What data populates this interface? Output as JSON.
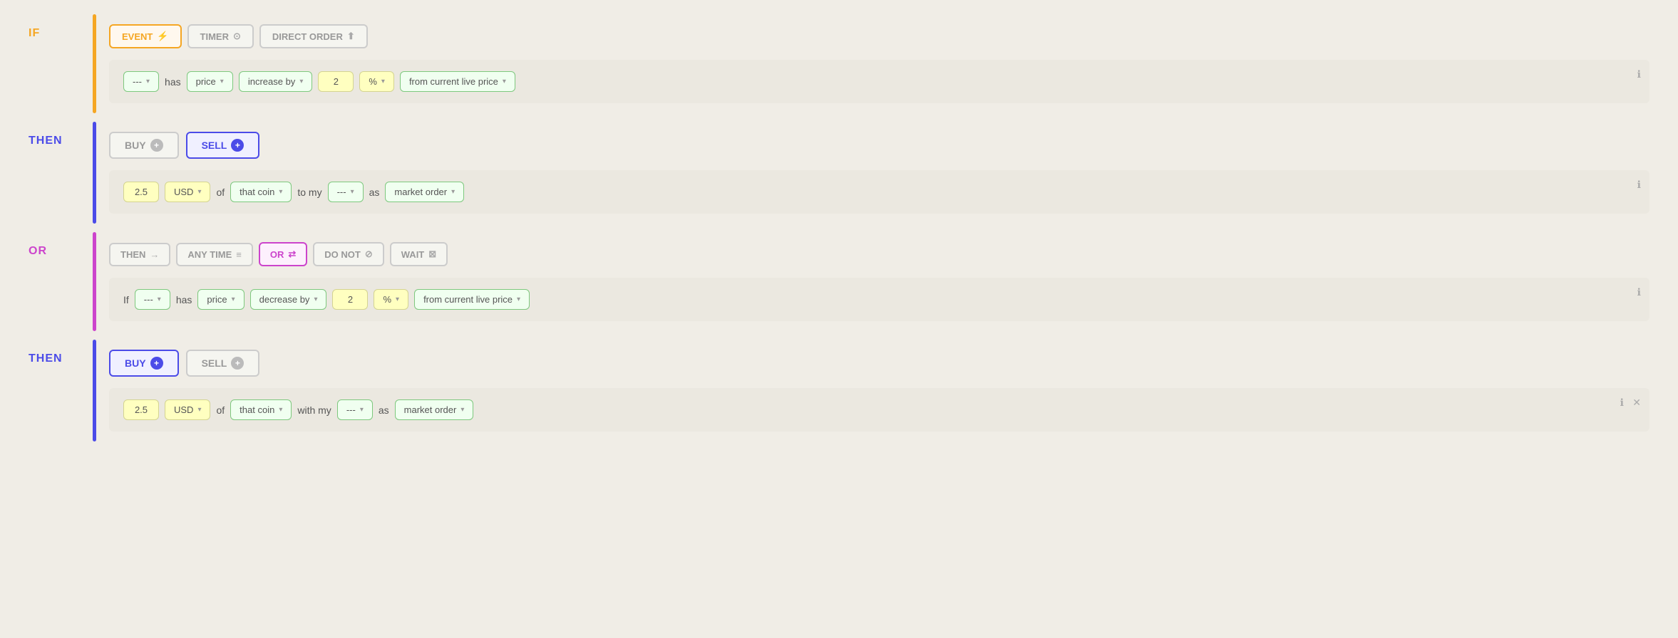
{
  "if_label": "IF",
  "then_label": "THEN",
  "or_label": "OR",
  "tabs": {
    "event_label": "EVENT",
    "timer_label": "TIMER",
    "direct_order_label": "DIRECT ORDER"
  },
  "condition1": {
    "coin_value": "---",
    "has_text": "has",
    "price_label": "price",
    "action_label": "increase by",
    "amount": "2",
    "percent_label": "%",
    "from_label": "from current live price"
  },
  "then1": {
    "buy_label": "BUY",
    "sell_label": "SELL",
    "amount": "2.5",
    "currency": "USD",
    "of_text": "of",
    "coin_label": "that coin",
    "to_my_text": "to my",
    "account_value": "---",
    "as_text": "as",
    "order_label": "market order"
  },
  "or_tabs": {
    "then_label": "THEN",
    "any_time_label": "ANY TIME",
    "or_label": "OR",
    "do_not_label": "DO NOT",
    "wait_label": "WAIT"
  },
  "condition2": {
    "if_text": "If",
    "coin_value": "---",
    "has_text": "has",
    "price_label": "price",
    "action_label": "decrease by",
    "amount": "2",
    "percent_label": "%",
    "from_label": "from current live price"
  },
  "then2": {
    "buy_label": "BUY",
    "sell_label": "SELL",
    "amount": "2.5",
    "currency": "USD",
    "of_text": "of",
    "coin_label": "that coin",
    "with_my_text": "with my",
    "account_value": "---",
    "as_text": "as",
    "order_label": "market order"
  },
  "colors": {
    "orange": "#f5a623",
    "blue": "#4b4be8",
    "pink": "#cc44cc",
    "green_border": "#7ec87e"
  }
}
